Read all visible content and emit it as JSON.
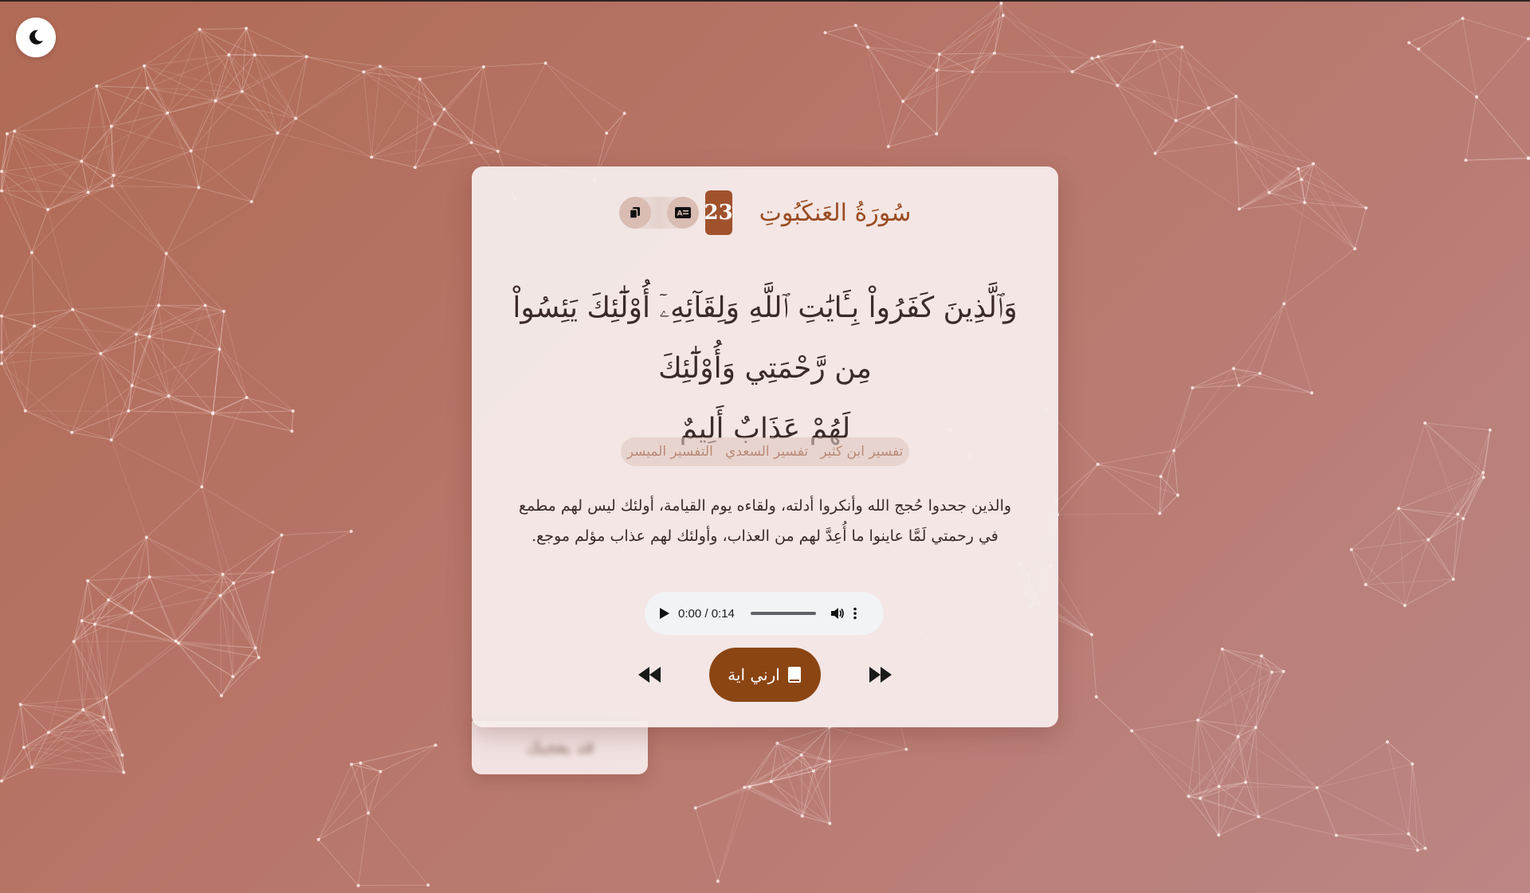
{
  "header": {
    "surah_name": "سُورَةُ العَنكَبُوتِ",
    "ayah_number": "23",
    "icons": [
      "copy-icon",
      "translate-icon"
    ]
  },
  "verse": {
    "line1": "وَٱلَّذِينَ كَفَرُواْ بِـَٔايَٰتِ ٱللَّهِ وَلِقَآئِهِۦٓ أُوْلَٰٓئِكَ يَئِسُواْ مِن رَّحْمَتِي وَأُوْلَٰٓئِكَ",
    "line2": "لَهُمْ عَذَابٌ أَلِيمٌ"
  },
  "tafsir": {
    "tabs": [
      "تفسير ابن كثير",
      "تفسير السعدي",
      "التفسير الميسر"
    ],
    "text": "والذين جحدوا حُجج الله وأنكروا أدلته، ولقاءه يوم القيامة، أولئك ليس لهم مطمع في رحمتي لَمَّا عاينوا ما أُعِدَّ لهم من العذاب، وأولئك لهم عذاب مؤلم موجع."
  },
  "audio": {
    "time": "0:00 / 0:14",
    "progress": 0
  },
  "controls": {
    "show_label": "ارني اية",
    "prev_icon": "rewind-icon",
    "next_icon": "fast-forward-icon"
  },
  "under_tab": {
    "label": "قد يعجبك"
  },
  "theme": {
    "icon": "moon-icon",
    "accent": "#a0522d",
    "button": "#8b4513",
    "background_start": "#b06a55",
    "background_end": "#bb8684"
  }
}
